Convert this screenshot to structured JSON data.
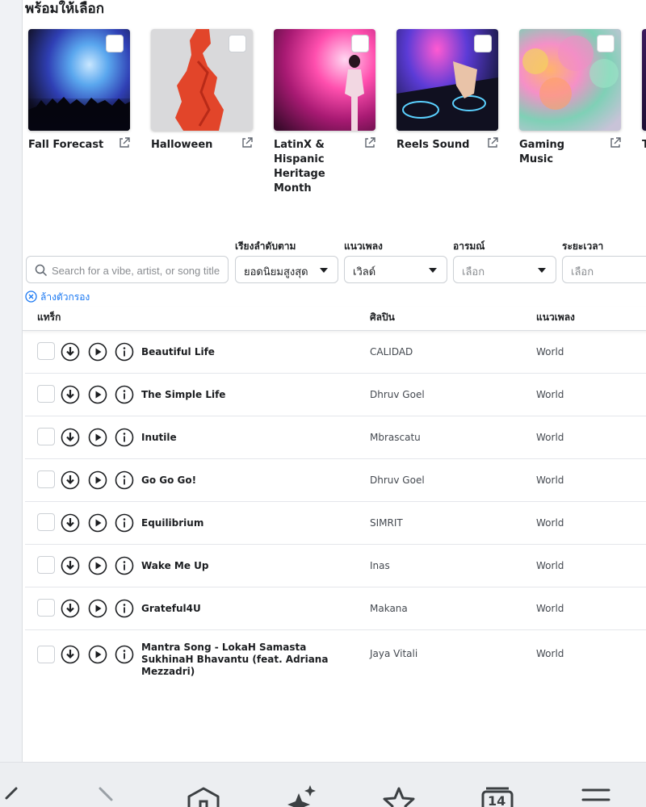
{
  "section": {
    "title": "พร้อมให้เลือก"
  },
  "playlists": [
    {
      "name": "Fall Forecast",
      "thumb": "concert-crowd-blue"
    },
    {
      "name": "Halloween",
      "thumb": "red-figure"
    },
    {
      "name": "LatinX & Hispanic Heritage Month",
      "thumb": "singer-pink-stage"
    },
    {
      "name": "Reels Sound",
      "thumb": "dj-mixer"
    },
    {
      "name": "Gaming Music",
      "thumb": "color-powder-festival"
    },
    {
      "name": "T S",
      "thumb": "purple-partial"
    }
  ],
  "filters": {
    "sort_label": "เรียงลำดับตาม",
    "genre_label": "แนวเพลง",
    "mood_label": "อารมณ์",
    "duration_label": "ระยะเวลา",
    "search_placeholder": "Search for a vibe, artist, or song title",
    "sort_value": "ยอดนิยมสูงสุด",
    "genre_value": "เวิลด์",
    "mood_placeholder": "เลือก",
    "duration_placeholder": "เลือก",
    "clear_label": "ล้างตัวกรอง"
  },
  "table": {
    "headers": {
      "track": "แทร็ก",
      "artist": "ศิลปิน",
      "genre": "แนวเพลง"
    },
    "rows": [
      {
        "title": "Beautiful Life",
        "artist": "CALIDAD",
        "genre": "World"
      },
      {
        "title": "The Simple Life",
        "artist": "Dhruv Goel",
        "genre": "World"
      },
      {
        "title": "Inutile",
        "artist": "Mbrascatu",
        "genre": "World"
      },
      {
        "title": "Go Go Go!",
        "artist": "Dhruv Goel",
        "genre": "World"
      },
      {
        "title": "Equilibrium",
        "artist": "SIMRIT",
        "genre": "World"
      },
      {
        "title": "Wake Me Up",
        "artist": "Inas",
        "genre": "World"
      },
      {
        "title": "Grateful4U",
        "artist": "Makana",
        "genre": "World"
      },
      {
        "title": "Mantra Song - LokaH Samasta SukhinaH Bhavantu (feat. Adriana Mezzadri)",
        "artist": "Jaya Vitali",
        "genre": "World"
      }
    ]
  },
  "browser_bar": {
    "icons": [
      "back-icon",
      "forward-icon",
      "home-icon",
      "sparkle-icon",
      "bookmark-star-icon",
      "tabs-icon",
      "menu-icon"
    ],
    "tab_count": "14"
  },
  "colors": {
    "link_blue": "#1877f2",
    "border": "#ccd0d5",
    "text": "#1c1e21"
  }
}
